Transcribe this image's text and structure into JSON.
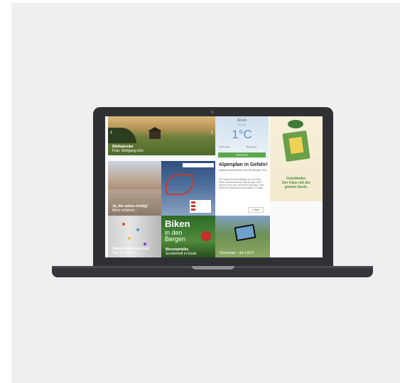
{
  "tiles": {
    "landscape": {
      "title": "Bildkalender",
      "subtitle": "Foto: Wolfgang Ehn",
      "prev": "‹",
      "next": "›"
    },
    "weather": {
      "city": "Beute",
      "city_sub": "Sonne",
      "temperature": "1°C",
      "left": "Vorhersage",
      "right": "Bergwetter",
      "button": "SERVICE"
    },
    "lake": {
      "title": "Ja, Sie sehen richtig!",
      "subtitle": "Mehr erfahren ›"
    },
    "article": {
      "title": "Alpenplan in Gefahr!",
      "subtitle": "Naturschutzverbände zum Riedberger Horn",
      "body": "Die Naturschutzverbände um den Bau einer Skischaukel am Riedberger Horn wehren sich seit mehreren Monaten. Nun steht der Bayerische Alpenplan in Frage.",
      "more": "» Mehr"
    },
    "cheese_ad": {
      "text1": "Grünländer.",
      "text2": "Der Käse mit der",
      "text3": "grünen Seele."
    },
    "climbing": {
      "title": "David Firnenburg holt",
      "subtitle": "Top 20-Plätze in"
    },
    "biking": {
      "word1": "Biken",
      "word2": "in den",
      "word3": "Bergen",
      "caption1": "Mountainbike",
      "caption2": "Sonderheft in Kiosk"
    },
    "tablet": {
      "caption": "Download – ab 4,99 €"
    }
  }
}
